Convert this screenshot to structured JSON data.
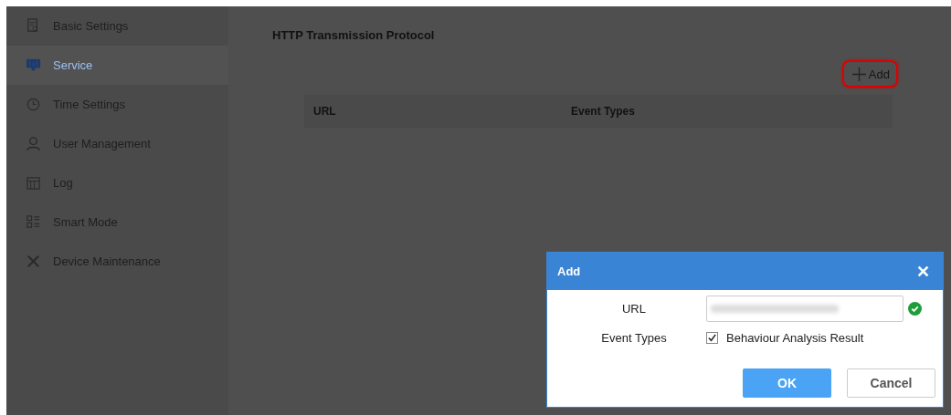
{
  "sidebar": {
    "items": [
      {
        "label": "Basic Settings",
        "selected": false
      },
      {
        "label": "Service",
        "selected": true
      },
      {
        "label": "Time Settings",
        "selected": false
      },
      {
        "label": "User Management",
        "selected": false
      },
      {
        "label": "Log",
        "selected": false
      },
      {
        "label": "Smart Mode",
        "selected": false
      },
      {
        "label": "Device Maintenance",
        "selected": false
      }
    ]
  },
  "main": {
    "title": "HTTP Transmission Protocol",
    "add_button": {
      "label": "Add",
      "highlighted": true
    },
    "table": {
      "columns": [
        "URL",
        "Event Types"
      ]
    }
  },
  "dialog": {
    "title": "Add",
    "close": "✕",
    "fields": [
      {
        "kind": "url",
        "label": "URL",
        "valid": true
      },
      {
        "kind": "checkbox",
        "label": "Event Types",
        "option": "Behaviour Analysis Result",
        "checked": true
      }
    ],
    "buttons": [
      {
        "label": "OK",
        "kind": "primary"
      },
      {
        "label": "Cancel",
        "kind": "secondary"
      }
    ]
  }
}
